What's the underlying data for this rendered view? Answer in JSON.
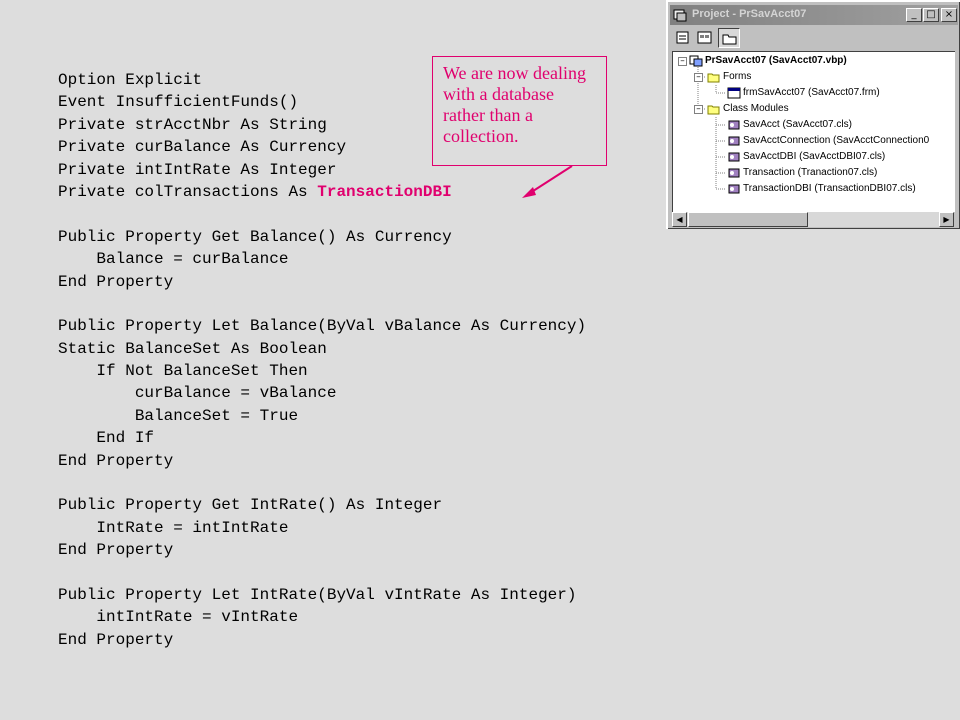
{
  "code": [
    {
      "text": "Option Explicit"
    },
    {
      "text": "Event InsufficientFunds()"
    },
    {
      "text": "Private strAcctNbr As String"
    },
    {
      "text": "Private curBalance As Currency"
    },
    {
      "text": "Private intIntRate As Integer"
    },
    {
      "text": "Private colTransactions As ",
      "highlight": "TransactionDBI"
    },
    {
      "text": ""
    },
    {
      "text": "Public Property Get Balance() As Currency"
    },
    {
      "text": "    Balance = curBalance"
    },
    {
      "text": "End Property"
    },
    {
      "text": ""
    },
    {
      "text": "Public Property Let Balance(ByVal vBalance As Currency)"
    },
    {
      "text": "Static BalanceSet As Boolean"
    },
    {
      "text": "    If Not BalanceSet Then"
    },
    {
      "text": "        curBalance = vBalance"
    },
    {
      "text": "        BalanceSet = True"
    },
    {
      "text": "    End If"
    },
    {
      "text": "End Property"
    },
    {
      "text": ""
    },
    {
      "text": "Public Property Get IntRate() As Integer"
    },
    {
      "text": "    IntRate = intIntRate"
    },
    {
      "text": "End Property"
    },
    {
      "text": ""
    },
    {
      "text": "Public Property Let IntRate(ByVal vIntRate As Integer)"
    },
    {
      "text": "    intIntRate = vIntRate"
    },
    {
      "text": "End Property"
    }
  ],
  "callout": {
    "text": "We are now dealing with a database rather than a collection."
  },
  "project_window": {
    "title": "Project - PrSavAcct07",
    "minimize_label": "_",
    "maximize_label": "□",
    "close_label": "×",
    "root": "PrSavAcct07 (SavAcct07.vbp)",
    "forms_folder": "Forms",
    "form_item": "frmSavAcct07 (SavAcct07.frm)",
    "class_folder": "Class Modules",
    "class_items": [
      "SavAcct (SavAcct07.cls)",
      "SavAcctConnection (SavAcctConnection0",
      "SavAcctDBI (SavAcctDBI07.cls)",
      "Transaction (Tranaction07.cls)",
      "TransactionDBI (TransactionDBI07.cls)"
    ],
    "scroll_left_label": "◀",
    "scroll_right_label": "▶"
  },
  "colors": {
    "background": "#dddddd",
    "accent": "#e0006e",
    "window_face": "#c0c0c0"
  }
}
